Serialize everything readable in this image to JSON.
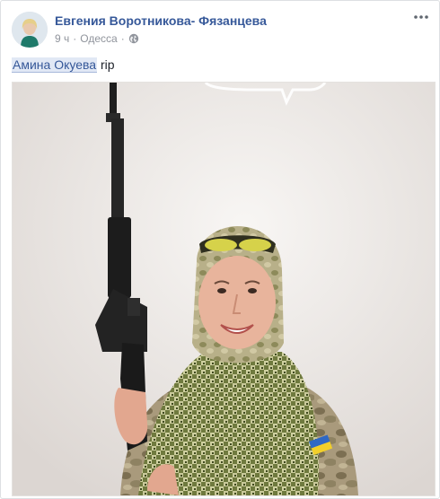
{
  "post": {
    "author_name": "Евгения Воротникова- Фязанцева",
    "time": "9 ч",
    "separator": "·",
    "location": "Одесса",
    "privacy_icon": "globe-icon",
    "more_icon": "more-options-icon",
    "text": {
      "mention": "Амина Окуева",
      "suffix": "rip"
    },
    "photo_label": "post-photo"
  },
  "colors": {
    "link": "#365899",
    "meta": "#90949c",
    "mention_bg": "#e1e8f5",
    "border": "#dddfe2"
  }
}
